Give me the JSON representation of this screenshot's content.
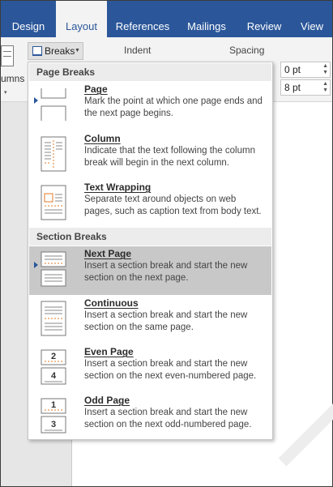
{
  "tabs": [
    {
      "label": "Design",
      "active": false
    },
    {
      "label": "Layout",
      "active": true
    },
    {
      "label": "References",
      "active": false
    },
    {
      "label": "Mailings",
      "active": false
    },
    {
      "label": "Review",
      "active": false
    },
    {
      "label": "View",
      "active": false
    }
  ],
  "ribbon": {
    "columns_label": "umns",
    "breaks_label": "Breaks",
    "indent_label": "Indent",
    "spacing_label": "Spacing",
    "spacing_before": "0 pt",
    "spacing_after": "8 pt"
  },
  "menu": {
    "page_breaks_header": "Page Breaks",
    "section_breaks_header": "Section Breaks",
    "items": [
      {
        "title": "Page",
        "desc": "Mark the point at which one page ends and the next page begins.",
        "icon": "page-break-icon"
      },
      {
        "title": "Column",
        "desc": "Indicate that the text following the column break will begin in the next column.",
        "icon": "column-break-icon"
      },
      {
        "title": "Text Wrapping",
        "desc": "Separate text around objects on web pages, such as caption text from body text.",
        "icon": "text-wrapping-icon"
      },
      {
        "title": "Next Page",
        "desc": "Insert a section break and start the new section on the next page.",
        "icon": "next-page-icon"
      },
      {
        "title": "Continuous",
        "desc": "Insert a section break and start the new section on the same page.",
        "icon": "continuous-icon"
      },
      {
        "title": "Even Page",
        "desc": "Insert a section break and start the new section on the next even-numbered page.",
        "icon": "even-page-icon",
        "num_a": "2",
        "num_b": "4"
      },
      {
        "title": "Odd Page",
        "desc": "Insert a section break and start the new section on the next odd-numbered page.",
        "icon": "odd-page-icon",
        "num_a": "1",
        "num_b": "3"
      }
    ],
    "highlighted_item": "Next Page"
  },
  "colors": {
    "ribbon_blue": "#2b579a",
    "break_orange": "#e07b2a",
    "highlight_gray": "#c8c8c8"
  }
}
